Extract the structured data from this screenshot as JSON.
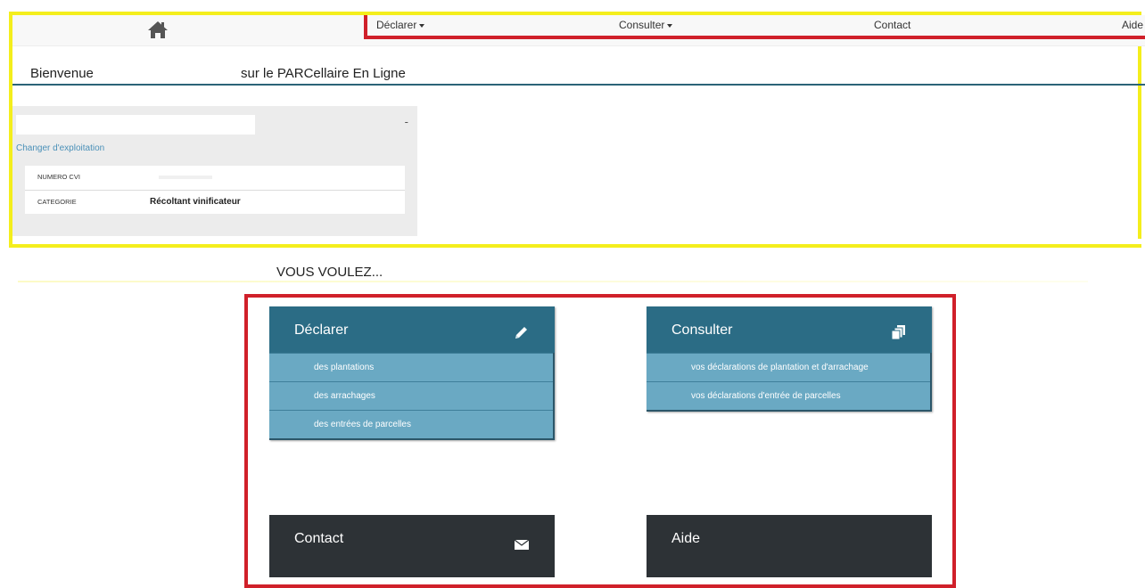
{
  "nav": {
    "home_icon": "home-icon",
    "declarer": "Déclarer",
    "consulter": "Consulter",
    "contact": "Contact",
    "aide": "Aide"
  },
  "welcome": {
    "part1": "Bienvenue",
    "part2": "sur le PARCellaire En Ligne"
  },
  "exploitation": {
    "collapse": "-",
    "change_link": "Changer d'exploitation",
    "rows": [
      {
        "label": "NUMERO CVI",
        "value": ""
      },
      {
        "label": "CATEGORIE",
        "value": "Récoltant vinificateur"
      }
    ]
  },
  "vous_voulez": "VOUS VOULEZ...",
  "tiles": {
    "declarer": {
      "title": "Déclarer",
      "icon": "pencil-icon",
      "items": [
        "des plantations",
        "des arrachages",
        "des entrées de parcelles"
      ]
    },
    "consulter": {
      "title": "Consulter",
      "icon": "documents-icon",
      "items": [
        "vos déclarations de plantation et d'arrachage",
        "vos déclarations d'entrée de parcelles"
      ]
    },
    "contact": {
      "title": "Contact",
      "icon": "envelope-icon"
    },
    "aide": {
      "title": "Aide"
    }
  },
  "colors": {
    "highlight_yellow": "#f4ee1c",
    "highlight_red": "#d0202a",
    "tile_teal": "#2b6c85",
    "tile_item": "#6aa9c3",
    "tile_dark": "#2d3236"
  }
}
